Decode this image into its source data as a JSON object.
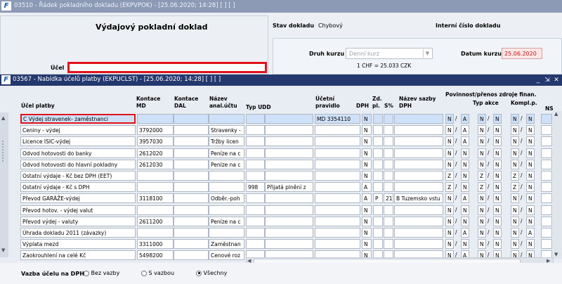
{
  "back_window": {
    "title": "03510 - Řádek pokladního dokladu (EKPVPOK) - [25.06.2020; 14:28] [ ] [ ]",
    "heading": "Výdajový pokladní doklad",
    "stav_label": "Stav dokladu",
    "stav_value": "Chybový",
    "interni_label": "Interní číslo dokladu",
    "druh_kurzu_label": "Druh kurzu",
    "druh_kurzu_value": "Denní kurz",
    "datum_kurzu_label": "Datum kurzu",
    "datum_kurzu_value": "25.06.2020",
    "kurz_text": "1 CHF =   25.033  CZK",
    "ucel_label": "Účel"
  },
  "popup": {
    "title": "03567 - Nabídka účelů platby (EKPUCLST) - [25.06.2020; 14:28] [ ] [ ]",
    "headers": {
      "ucel_platby": "Účel platby",
      "kontace_md": "Kontace\nMD",
      "kontace_dal": "Kontace\nDAL",
      "nazev_anal": "Název\nanal.účtu",
      "typ_udd": "Typ UDD",
      "ucetni_pravidlo": "Účetní\npravidlo",
      "dph": "DPH",
      "zd_pl": "Zd.\npl.",
      "s_pct": "S%",
      "nazev_sazby": "Název sazby\nDPH",
      "povinnost": "Povinnost/přenos zdroje finan.",
      "typ_akce": "Typ akce",
      "kompl": "Kompl.p.",
      "ns": "NS"
    },
    "rows": [
      {
        "ucel": "C Výdej stravenek- zaměstnanci",
        "md": "",
        "dal": "",
        "anal": "",
        "typ": "",
        "typnazev": "",
        "pravidlo": "MD 3354110",
        "dph": "N",
        "zd": "",
        "s": "",
        "sazba": "",
        "f": [
          "N",
          "/",
          "A",
          "N",
          "/",
          "N",
          "N",
          "/",
          "N"
        ]
      },
      {
        "ucel": "Ceniny - výdej",
        "md": "3792000",
        "dal": "",
        "anal": "Stravenky -",
        "typ": "",
        "typnazev": "",
        "pravidlo": "",
        "dph": "N",
        "zd": "",
        "s": "",
        "sazba": "",
        "f": [
          "N",
          "/",
          "A",
          "N",
          "/",
          "N",
          "N",
          "/",
          "N"
        ]
      },
      {
        "ucel": "Licence ISIC-výdej",
        "md": "3957030",
        "dal": "",
        "anal": "Tržby licen",
        "typ": "",
        "typnazev": "",
        "pravidlo": "",
        "dph": "N",
        "zd": "",
        "s": "",
        "sazba": "",
        "f": [
          "N",
          "/",
          "A",
          "N",
          "/",
          "N",
          "N",
          "/",
          "N"
        ]
      },
      {
        "ucel": "Odvod hotovosti do banky",
        "md": "2612020",
        "dal": "",
        "anal": "Peníze na c",
        "typ": "",
        "typnazev": "",
        "pravidlo": "",
        "dph": "N",
        "zd": "",
        "s": "",
        "sazba": "",
        "f": [
          "N",
          "/",
          "N",
          "N",
          "/",
          "N",
          "N",
          "/",
          "N"
        ]
      },
      {
        "ucel": "Odvod hotovosti do hlavní pokladny",
        "md": "2612030",
        "dal": "",
        "anal": "Peníze na c",
        "typ": "",
        "typnazev": "",
        "pravidlo": "",
        "dph": "N",
        "zd": "",
        "s": "",
        "sazba": "",
        "f": [
          "N",
          "/",
          "N",
          "N",
          "/",
          "N",
          "N",
          "/",
          "N"
        ]
      },
      {
        "ucel": "Ostatní výdaje - Kč bez DPH (EET)",
        "md": "",
        "dal": "",
        "anal": "",
        "typ": "",
        "typnazev": "",
        "pravidlo": "",
        "dph": "N",
        "zd": "",
        "s": "",
        "sazba": "",
        "f": [
          "Z",
          "/",
          "N",
          "Z",
          "/",
          "N",
          "Z",
          "/",
          "N"
        ]
      },
      {
        "ucel": "Ostatní výdaje - Kč s DPH",
        "md": "",
        "dal": "",
        "anal": "",
        "typ": "998",
        "typnazev": "Přijatá plnění z",
        "pravidlo": "",
        "dph": "A",
        "zd": "",
        "s": "",
        "sazba": "",
        "f": [
          "Z",
          "/",
          "N",
          "Z",
          "/",
          "N",
          "Z",
          "/",
          "N"
        ]
      },
      {
        "ucel": "Převod GARÁŽE-výdej",
        "md": "3118100",
        "dal": "",
        "anal": "Odběr.-poh",
        "typ": "",
        "typnazev": "",
        "pravidlo": "",
        "dph": "A",
        "zd": "P",
        "s": "21",
        "sazba": "B  Tuzemsko vstu",
        "f": [
          "N",
          "/",
          "A",
          "N",
          "/",
          "N",
          "N",
          "/",
          "N"
        ]
      },
      {
        "ucel": "Převod hotov. - výdej valut",
        "md": "",
        "dal": "",
        "anal": "",
        "typ": "",
        "typnazev": "",
        "pravidlo": "",
        "dph": "N",
        "zd": "",
        "s": "",
        "sazba": "",
        "f": [
          "N",
          "/",
          "N",
          "N",
          "/",
          "N",
          "N",
          "/",
          "N"
        ]
      },
      {
        "ucel": "Převod výdej - valuty",
        "md": "2611200",
        "dal": "",
        "anal": "Peníze na c",
        "typ": "",
        "typnazev": "",
        "pravidlo": "",
        "dph": "N",
        "zd": "",
        "s": "",
        "sazba": "",
        "f": [
          "N",
          "/",
          "N",
          "N",
          "/",
          "N",
          "N",
          "/",
          "N"
        ]
      },
      {
        "ucel": "Úhrada dokladu 2011 (závazky)",
        "md": "",
        "dal": "",
        "anal": "",
        "typ": "",
        "typnazev": "",
        "pravidlo": "",
        "dph": "N",
        "zd": "",
        "s": "",
        "sazba": "",
        "f": [
          "N",
          "/",
          "A",
          "N",
          "/",
          "N",
          "N",
          "/",
          "A"
        ]
      },
      {
        "ucel": "Výplata mezd",
        "md": "3311000",
        "dal": "",
        "anal": "Zaměstnan",
        "typ": "",
        "typnazev": "",
        "pravidlo": "",
        "dph": "N",
        "zd": "",
        "s": "",
        "sazba": "",
        "f": [
          "N",
          "/",
          "N",
          "N",
          "/",
          "N",
          "N",
          "/",
          "N"
        ]
      },
      {
        "ucel": "Zaokrouhlení na celé Kč",
        "md": "5498200",
        "dal": "",
        "anal": "Cenové roz",
        "typ": "",
        "typnazev": "",
        "pravidlo": "",
        "dph": "N",
        "zd": "",
        "s": "",
        "sazba": "",
        "f": [
          "N",
          "/",
          "A",
          "N",
          "/",
          "N",
          "N",
          "/",
          "N"
        ]
      }
    ],
    "vazba_label": "Vazba účelu na DPH",
    "radio_options": [
      "Bez vazby",
      "S vazbou",
      "Všechny"
    ],
    "radio_selected": "Všechny"
  }
}
